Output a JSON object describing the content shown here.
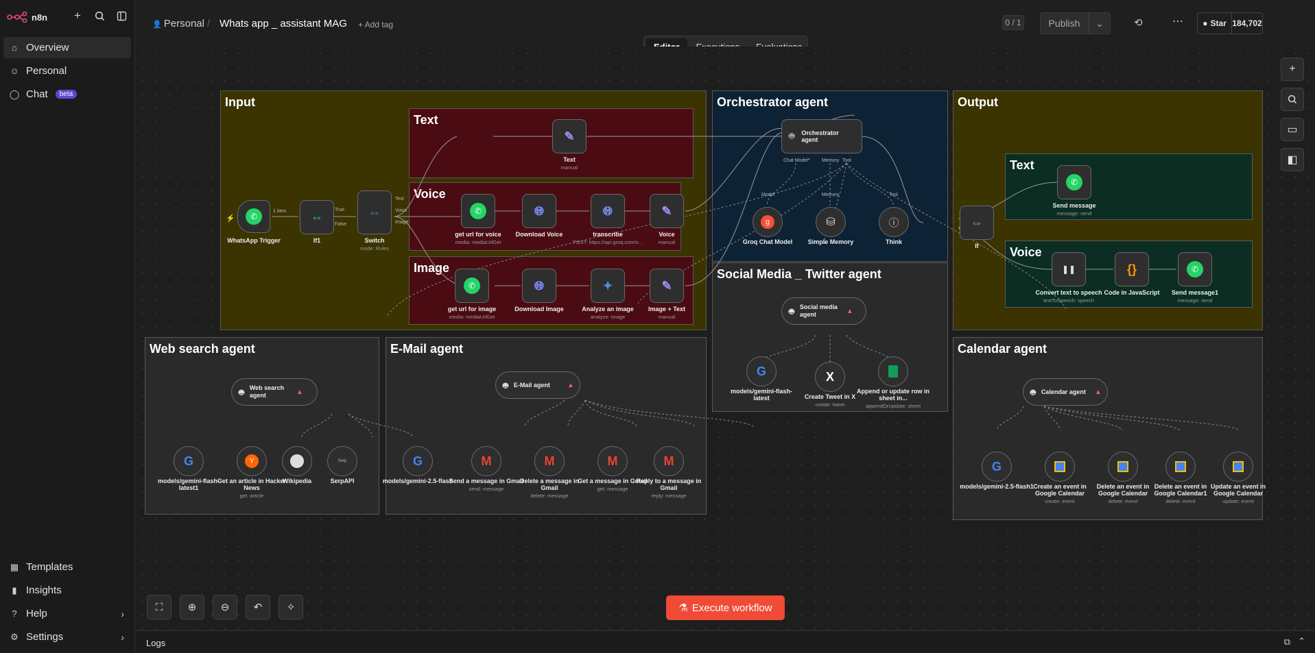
{
  "app": {
    "name": "n8n"
  },
  "sidebar": {
    "items": [
      {
        "label": "Overview",
        "icon": "home-icon"
      },
      {
        "label": "Personal",
        "icon": "user-icon"
      },
      {
        "label": "Chat",
        "icon": "chat-icon",
        "badge": "beta"
      }
    ],
    "bottom": [
      {
        "label": "Templates",
        "icon": "templates-icon"
      },
      {
        "label": "Insights",
        "icon": "insights-icon"
      },
      {
        "label": "Help",
        "icon": "help-icon"
      },
      {
        "label": "Settings",
        "icon": "gear-icon"
      }
    ]
  },
  "header": {
    "project": "Personal",
    "workflow": "Whats app _ assistant MAG",
    "add_tag": "+ Add tag",
    "counter": "0 / 1",
    "publish": "Publish",
    "star": "Star",
    "star_count": "184,702"
  },
  "tabs": [
    "Editor",
    "Executions",
    "Evaluations"
  ],
  "stickies": {
    "input": "Input",
    "text": "Text",
    "voice": "Voice",
    "image": "Image",
    "orchestrator": "Orchestrator agent",
    "output": "Output",
    "out_text": "Text",
    "out_voice": "Voice",
    "social": "Social Media _ Twitter agent",
    "web": "Web search agent",
    "email": "E-Mail agent",
    "calendar": "Calendar agent"
  },
  "nodes": {
    "trigger": {
      "label": "WhatsApp Trigger"
    },
    "if1": {
      "label": "If1"
    },
    "switch": {
      "label": "Switch",
      "sub": "mode: Rules"
    },
    "text": {
      "label": "Text",
      "sub": "manual"
    },
    "url_voice": {
      "label": "get url for voice",
      "sub": "media: mediaUrlGet"
    },
    "dl_voice": {
      "label": "Download Voice"
    },
    "transcribe": {
      "label": "transcribe",
      "sub": "POST: https://api.groq.com/o..."
    },
    "voice": {
      "label": "Voice",
      "sub": "manual"
    },
    "url_image": {
      "label": "get url for image",
      "sub": "media: mediaUrlGet"
    },
    "dl_image": {
      "label": "Download Image"
    },
    "analyze": {
      "label": "Analyze an image",
      "sub": "analyze: image"
    },
    "img_text": {
      "label": "Image + Text",
      "sub": "manual"
    },
    "orch": {
      "label": "Orchestrator agent"
    },
    "groq": {
      "label": "Groq Chat Model"
    },
    "memory": {
      "label": "Simple Memory"
    },
    "think": {
      "label": "Think"
    },
    "if": {
      "label": "If"
    },
    "send": {
      "label": "Send message",
      "sub": "message: send"
    },
    "tts": {
      "label": "Convert text to speech",
      "sub": "textToSpeech: speech"
    },
    "code": {
      "label": "Code in JavaScript"
    },
    "send1": {
      "label": "Send message1",
      "sub": "message: send"
    },
    "social_agent": {
      "label": "Social media agent"
    },
    "gem_latest": {
      "label": "models/gemini-flash-latest"
    },
    "tweet": {
      "label": "Create Tweet in X",
      "sub": "create: tweet"
    },
    "sheet": {
      "label": "Append or update row in sheet in...",
      "sub": "appendOrUpdate: sheet"
    },
    "web_agent": {
      "label": "Web search agent"
    },
    "gem_latest1": {
      "label": "models/gemini-flash-latest1"
    },
    "hn": {
      "label": "Get an article in Hacker News",
      "sub": "get: article"
    },
    "wiki": {
      "label": "Wikipedia"
    },
    "serp": {
      "label": "SerpAPI"
    },
    "email_agent": {
      "label": "E-Mail agent"
    },
    "gem25": {
      "label": "models/gemini-2.5-flash"
    },
    "gm_send": {
      "label": "Send a message in Gmail",
      "sub": "send: message"
    },
    "gm_del": {
      "label": "Delete a message in Gmail",
      "sub": "delete: message"
    },
    "gm_get": {
      "label": "Get a message in Gmail",
      "sub": "get: message"
    },
    "gm_reply": {
      "label": "Reply to a message in Gmail",
      "sub": "reply: message"
    },
    "cal_agent": {
      "label": "Calendar agent"
    },
    "gem25_1": {
      "label": "models/gemini-2.5-flash1"
    },
    "cal_create": {
      "label": "Create an event in Google Calendar",
      "sub": "create: event"
    },
    "cal_del": {
      "label": "Delete an event in Google Calendar",
      "sub": "delete: event"
    },
    "cal_del1": {
      "label": "Delete an event in Google Calendar1",
      "sub": "delete: event"
    },
    "cal_upd": {
      "label": "Update an event in Google Calendar",
      "sub": "update: event"
    }
  },
  "ports": {
    "chat_model": "Chat Model*",
    "memory": "Memory",
    "tool": "Tool",
    "model": "Model",
    "item": "1 item",
    "true": "True",
    "false": "False",
    "text": "Text",
    "voice": "Voice",
    "image": "Image"
  },
  "footer": {
    "execute": "Execute workflow",
    "logs": "Logs"
  },
  "colors": {
    "accent": "#ef4b36",
    "sticky_yellow": "#3b3300",
    "sticky_red": "#4a0b12",
    "sticky_blue": "#0e2235",
    "sticky_green": "#0b2d22",
    "sticky_gray": "#2a2a2a"
  }
}
